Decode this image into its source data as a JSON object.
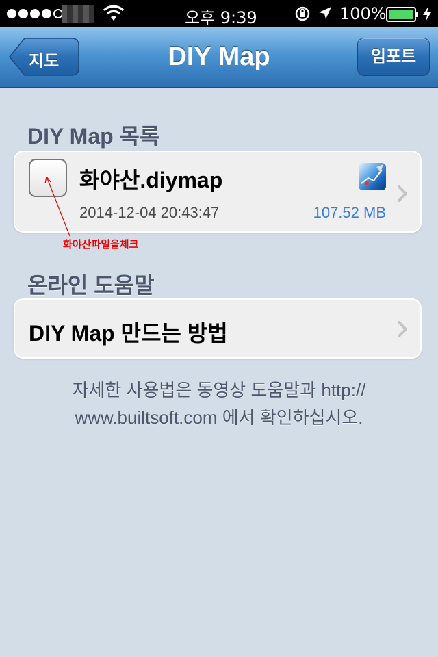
{
  "status_bar": {
    "time": "오후 9:39",
    "battery_percent": "100%",
    "signal_bars_filled": 4,
    "signal_bars_total": 5
  },
  "nav": {
    "title": "DIY Map",
    "back_label": "지도",
    "import_label": "임포트"
  },
  "file_section": {
    "header": "DIY Map 목록",
    "items": [
      {
        "name": "화야산.diymap",
        "date": "2014-12-04 20:43:47",
        "size": "107.52 MB",
        "thumbnail_icon": "map-thumbnail-icon"
      }
    ],
    "annotation": "화야산파일을체크"
  },
  "help_section": {
    "header": "온라인 도움말",
    "items": [
      {
        "label": "DIY Map 만드는 방법"
      }
    ]
  },
  "footer": {
    "line1": "자세한 사용법은 동영상 도움말과 http://",
    "line2": "www.builtsoft.com 에서 확인하십시오."
  },
  "colors": {
    "background": "#d3dde8",
    "nav_blue": "#2c6fb2",
    "size_blue": "#3b7dd8",
    "annotation_red": "#e00000",
    "battery_green": "#4cd964"
  }
}
